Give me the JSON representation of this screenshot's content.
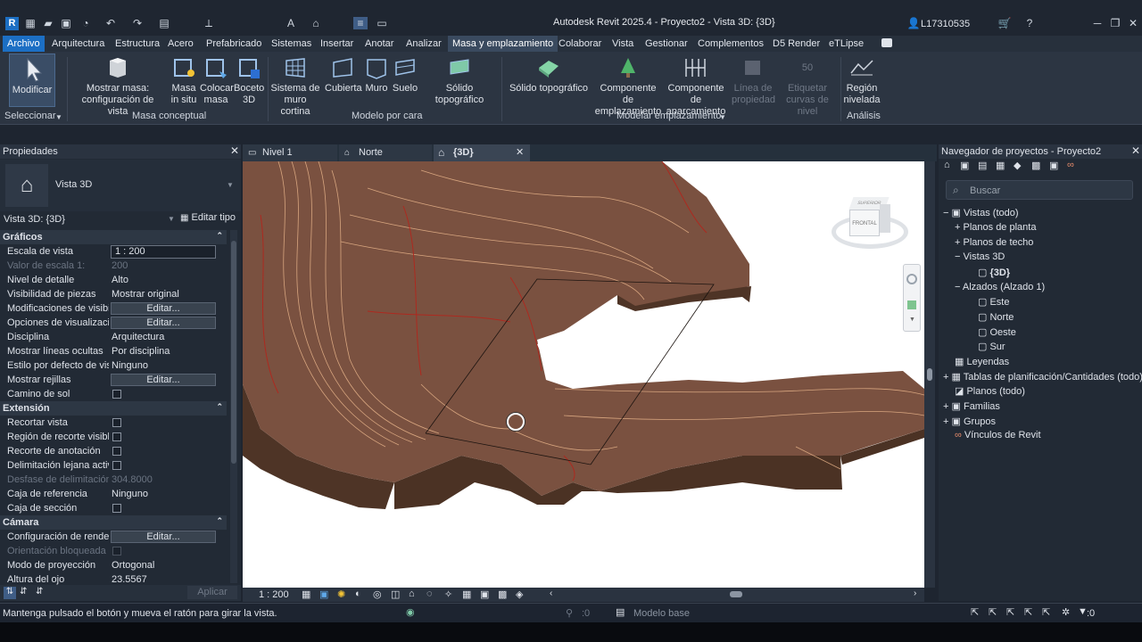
{
  "title": "Autodesk Revit 2025.4 - Proyecto2 - Vista 3D: {3D}",
  "user": "L17310535",
  "menu": [
    "Archivo",
    "Arquitectura",
    "Estructura",
    "Acero",
    "Prefabricado",
    "Sistemas",
    "Insertar",
    "Anotar",
    "Analizar",
    "Masa y emplazamiento",
    "Colaborar",
    "Vista",
    "Gestionar",
    "Complementos",
    "D5 Render",
    "eTLipse"
  ],
  "ribbon": {
    "modificar": "Modificar",
    "seleccionar": "Seleccionar",
    "mostrar_masa": [
      "Mostrar masa:",
      "configuración de vista"
    ],
    "masa_in_situ": [
      "Masa",
      "in situ"
    ],
    "colocar_masa": [
      "Colocar",
      "masa"
    ],
    "boceto_3d": [
      "Boceto",
      "3D"
    ],
    "masa_conceptual": "Masa conceptual",
    "sistema_muro": [
      "Sistema de",
      "muro cortina"
    ],
    "cubierta": "Cubierta",
    "muro": "Muro",
    "suelo": "Suelo",
    "solido_topo_1": "Sólido topográfico",
    "modelo_por_cara": "Modelo por cara",
    "solido_topo_2": "Sólido topográfico",
    "componente_emplazamiento": [
      "Componente de",
      "emplazamiento"
    ],
    "componente_aparcamiento": [
      "Componente de",
      "aparcamiento"
    ],
    "linea_propiedad": [
      "Línea de",
      "propiedad"
    ],
    "etiquetar_curvas": [
      "Etiquetar",
      "curvas de nivel"
    ],
    "modelar_emplazamiento": "Modelar emplazamiento",
    "region_nivelada": [
      "Región",
      "nivelada"
    ],
    "analisis": "Análisis"
  },
  "properties": {
    "header": "Propiedades",
    "type_name": "Vista 3D",
    "selector": "Vista 3D: {3D}",
    "edit_type": "Editar tipo",
    "sections": {
      "graficos": "Gráficos",
      "extension": "Extensión",
      "camara": "Cámara"
    },
    "rows": [
      {
        "k": "Escala de vista",
        "v": "1 : 200"
      },
      {
        "k": "Valor de escala    1:",
        "v": "200"
      },
      {
        "k": "Nivel de detalle",
        "v": "Alto"
      },
      {
        "k": "Visibilidad de piezas",
        "v": "Mostrar original"
      },
      {
        "k": "Modificaciones de visibi...",
        "v": "Editar..."
      },
      {
        "k": "Opciones de visualizació...",
        "v": "Editar..."
      },
      {
        "k": "Disciplina",
        "v": "Arquitectura"
      },
      {
        "k": "Mostrar líneas ocultas",
        "v": "Por disciplina"
      },
      {
        "k": "Estilo por defecto de vis...",
        "v": "Ninguno"
      },
      {
        "k": "Mostrar rejillas",
        "v": "Editar..."
      },
      {
        "k": "Camino de sol",
        "v": ""
      },
      {
        "k": "Recortar vista",
        "v": ""
      },
      {
        "k": "Región de recorte visible",
        "v": ""
      },
      {
        "k": "Recorte de anotación",
        "v": ""
      },
      {
        "k": "Delimitación lejana activa",
        "v": ""
      },
      {
        "k": "Desfase de delimitación...",
        "v": "304.8000"
      },
      {
        "k": "Caja de referencia",
        "v": "Ninguno"
      },
      {
        "k": "Caja de sección",
        "v": ""
      },
      {
        "k": "Configuración de render...",
        "v": "Editar..."
      },
      {
        "k": "Orientación bloqueada",
        "v": ""
      },
      {
        "k": "Modo de proyección",
        "v": "Ortogonal"
      },
      {
        "k": "Altura del ojo",
        "v": "23.5567"
      }
    ],
    "apply": "Aplicar"
  },
  "tabs": [
    "Nivel 1",
    "Norte",
    "{3D}"
  ],
  "viewbar": {
    "scale": "1 : 200"
  },
  "viewcube": {
    "top": "SUPERIOR",
    "front": "FRONTAL"
  },
  "browser": {
    "header": "Navegador de proyectos - Proyecto2",
    "search": "Buscar",
    "items": [
      "Vistas (todo)",
      "Planos de planta",
      "Planos de techo",
      "Vistas 3D",
      "{3D}",
      "Alzados (Alzado 1)",
      "Este",
      "Norte",
      "Oeste",
      "Sur",
      "Leyendas",
      "Tablas de planificación/Cantidades (todo)",
      "Planos (todo)",
      "Familias",
      "Grupos",
      "Vínculos de Revit"
    ]
  },
  "status": {
    "message": "Mantenga pulsado el botón y mueva el ratón para girar la vista.",
    "model": "Modelo base",
    "count_a": ":0",
    "count_b": ":0"
  },
  "colors": {
    "accent": "#1c6fc4",
    "terrain": "#7a5140",
    "terrain_side": "#4e3426",
    "contour": "#e8b48a",
    "contour_red": "#b3251c"
  }
}
